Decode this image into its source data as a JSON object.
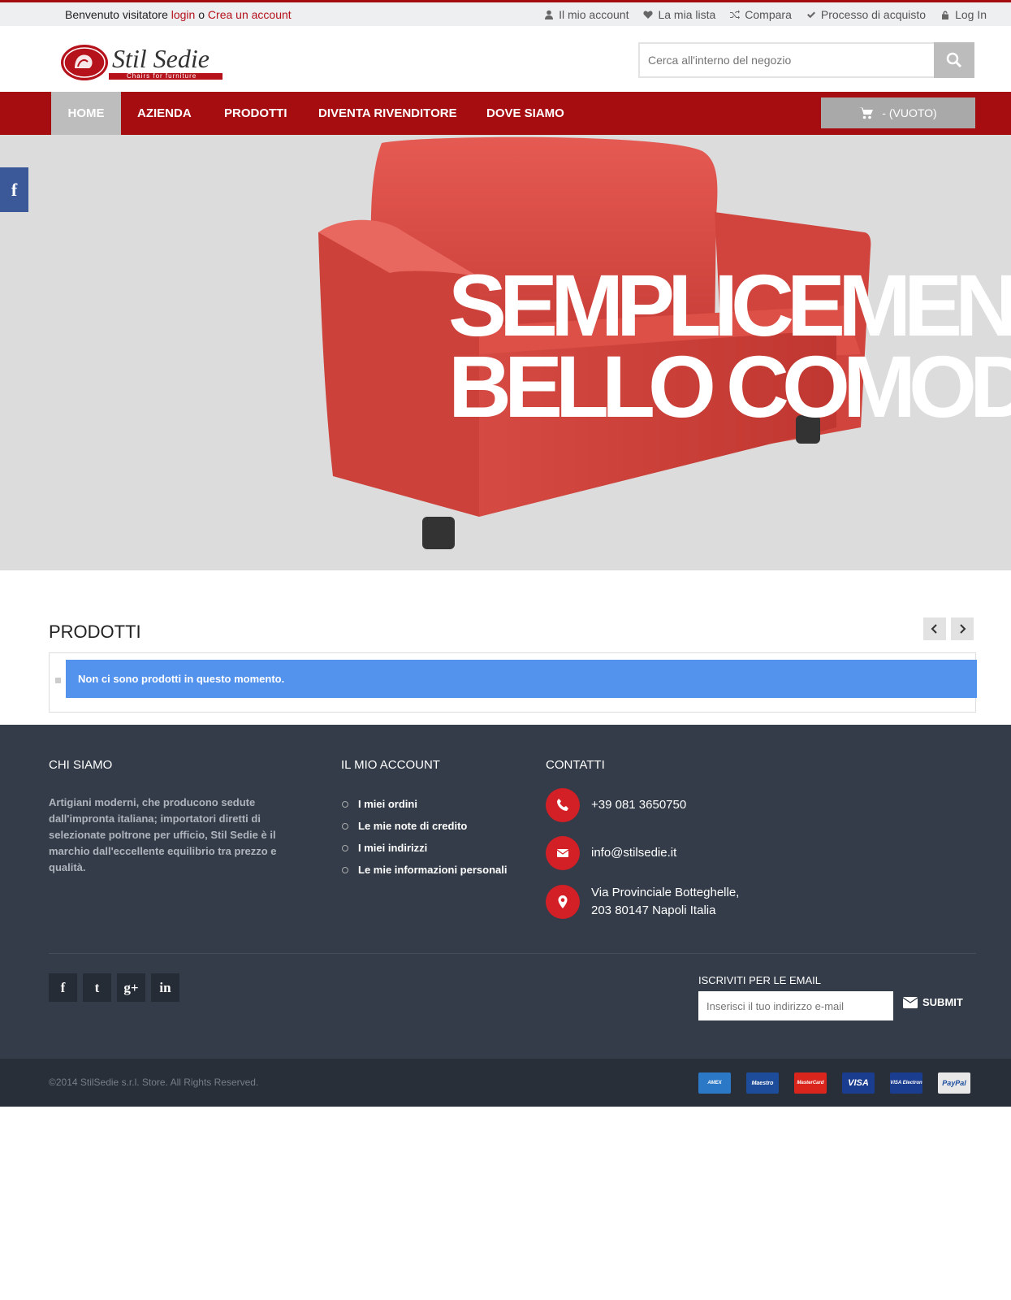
{
  "topbar": {
    "welcome": "Benvenuto visitatore",
    "login": "login",
    "or": "o",
    "create_account": "Crea un account",
    "links": [
      {
        "label": "Il mio account",
        "icon": "user-icon"
      },
      {
        "label": "La mia lista",
        "icon": "heart-icon"
      },
      {
        "label": "Compara",
        "icon": "shuffle-icon"
      },
      {
        "label": "Processo di acquisto",
        "icon": "check-icon"
      },
      {
        "label": "Log In",
        "icon": "lock-icon"
      }
    ]
  },
  "header": {
    "logo_title": "Stil Sedie",
    "logo_tagline": "Chairs for furniture",
    "search_placeholder": "Cerca all'interno del negozio"
  },
  "nav": {
    "items": [
      "HOME",
      "AZIENDA",
      "PRODOTTI",
      "DIVENTA RIVENDITORE",
      "DOVE SIAMO"
    ],
    "active": "HOME",
    "cart_label": "- (VUOTO)"
  },
  "hero": {
    "line1": "SEMPLICEMENTE",
    "line2": "BELLO COMODO",
    "side_social": "f"
  },
  "products": {
    "title": "PRODOTTI",
    "empty_message": "Non ci sono prodotti in questo momento."
  },
  "footer": {
    "about_title": "CHI SIAMO",
    "about_text": "Artigiani moderni, che producono sedute dall'impronta italiana; importatori diretti di selezionate poltrone per ufficio, Stil Sedie è il marchio dall'eccellente equilibrio tra prezzo e qualità.",
    "account_title": "IL MIO ACCOUNT",
    "account_links": [
      "I miei ordini",
      "Le mie note di credito",
      "I miei indirizzi",
      "Le mie informazioni personali"
    ],
    "contacts_title": "CONTATTI",
    "phone": "+39 081 3650750",
    "email": "info@stilsedie.it",
    "address_line1": "Via Provinciale Botteghelle,",
    "address_line2": "203 80147 Napoli Italia",
    "social": [
      "f",
      "t",
      "g+",
      "in"
    ],
    "newsletter_title": "ISCRIVITI PER LE EMAIL",
    "newsletter_placeholder": "Inserisci il tuo indirizzo e-mail",
    "submit": "SUBMIT",
    "copyright": "©2014 StilSedie s.r.l. Store. All Rights Reserved.",
    "payments": [
      {
        "label": "AMEX",
        "color": "#2a78c6"
      },
      {
        "label": "Maestro",
        "color": "#1d4c9a"
      },
      {
        "label": "MasterCard",
        "color": "#d9251c"
      },
      {
        "label": "VISA",
        "color": "#1a3d8f"
      },
      {
        "label": "VISA Electron",
        "color": "#1a3d8f"
      },
      {
        "label": "PayPal",
        "color": "#e8e8e8"
      }
    ]
  },
  "colors": {
    "brand_red": "#a60d10",
    "accent_red": "#d31f26",
    "alert_blue": "#5392ed",
    "footer_bg": "#333c48"
  }
}
